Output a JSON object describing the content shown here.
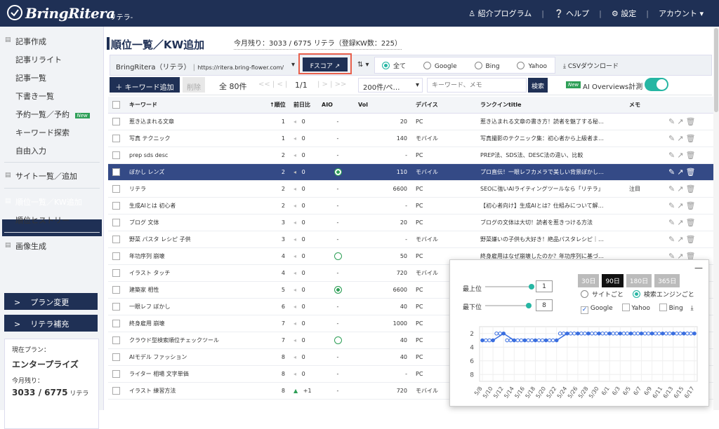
{
  "header": {
    "logo": "BringRitera",
    "logo_sub": "-リテラ-",
    "nav": [
      "紹介プログラム",
      "ヘルプ",
      "設定",
      "アカウント"
    ]
  },
  "sidebar": {
    "items": [
      "記事作成",
      "記事リライト",
      "記事一覧",
      "下書き一覧",
      "予約一覧／予約",
      "キーワード探索",
      "自由入力",
      "サイト一覧／追加",
      "順位一覧／KW追加",
      "順位ヒストリー",
      "画像生成"
    ],
    "new_badge": "New",
    "plan_change": "プラン変更",
    "ritera_refill": "リテラ補充",
    "plan_label": "現在プラン：",
    "plan_name": "エンタープライズ",
    "remaining_label": "今月残り：",
    "remaining_value": "3033 / 6775",
    "remaining_unit": "リテラ"
  },
  "main": {
    "title": "順位一覧／KW追加",
    "remain": "今月残り：3033 / 6775 リテラ（登録KW数：225）",
    "site_name": "BringRitera（リテラ）",
    "site_url": "https://ritera.bring-flower.com/",
    "fscore": "Fスコア",
    "filters": [
      "全て",
      "Google",
      "Bing",
      "Yahoo"
    ],
    "csv": "CSVダウンロード",
    "add_kw": "＋ キーワード追加",
    "delete": "削除",
    "total": "全 80件",
    "page": "1/1",
    "per_page": "200件/ペ…",
    "search_placeholder": "キーワード、メモ",
    "search_btn": "検索",
    "ai_badge": "New",
    "ai_label": "AI Overviews計測"
  },
  "table": {
    "headers": [
      "キーワード",
      "順位",
      "前日比",
      "AIO",
      "Vol",
      "デバイス",
      "ランクインtitle",
      "メモ"
    ],
    "rows": [
      [
        "惹き込まれる文章",
        "1",
        "0",
        "-",
        "20",
        "PC",
        "惹き込まれる文章の書き方！読者を魅了する秘…",
        ""
      ],
      [
        "写真 テクニック",
        "1",
        "0",
        "-",
        "140",
        "モバイル",
        "写真撮影のテクニック集：初心者から上級者ま…",
        ""
      ],
      [
        "prep sds desc",
        "2",
        "0",
        "-",
        "-",
        "PC",
        "PREP法、SDS法、DESC法の違い、比較",
        ""
      ],
      [
        "ぼかし レンズ",
        "2",
        "0",
        "g",
        "110",
        "モバイル",
        "プロ直伝！一眼レフカメラで美しい背景ぼかし…",
        ""
      ],
      [
        "リテラ",
        "2",
        "0",
        "-",
        "6600",
        "PC",
        "SEOに強いAIライティングツールなら「リテラ」",
        "注目"
      ],
      [
        "生成AIとは 初心者",
        "2",
        "0",
        "-",
        "-",
        "PC",
        "【初心者向け】生成AIとは？仕組みについて解…",
        ""
      ],
      [
        "ブログ 文体",
        "3",
        "0",
        "-",
        "20",
        "PC",
        "ブログの文体は大切！読者を惹きつける方法",
        ""
      ],
      [
        "野菜 パスタ レシピ 子供",
        "3",
        "0",
        "-",
        "-",
        "モバイル",
        "野菜嫌いの子供も大好き！絶品パスタレシピ｜…",
        ""
      ],
      [
        "年功序列 崩壊",
        "4",
        "0",
        "c",
        "50",
        "PC",
        "終身雇用はなぜ崩壊したのか？年功序列に基づ…",
        ""
      ],
      [
        "イラスト タッチ",
        "4",
        "0",
        "-",
        "720",
        "モバイル",
        "",
        ""
      ],
      [
        "建築家 相性",
        "5",
        "0",
        "g",
        "6600",
        "PC",
        "",
        ""
      ],
      [
        "一眼レフ ぼかし",
        "6",
        "0",
        "-",
        "40",
        "PC",
        "",
        ""
      ],
      [
        "終身雇用 崩壊",
        "7",
        "0",
        "-",
        "1000",
        "PC",
        "",
        ""
      ],
      [
        "クラウド型検索順位チェックツール",
        "7",
        "0",
        "c",
        "40",
        "PC",
        "",
        ""
      ],
      [
        "AIモデル ファッション",
        "8",
        "0",
        "-",
        "40",
        "PC",
        "",
        ""
      ],
      [
        "ライター 相場 文字単価",
        "8",
        "0",
        "-",
        "-",
        "PC",
        "",
        ""
      ],
      [
        "イラスト 練習方法",
        "8",
        "+1",
        "-",
        "720",
        "モバイル",
        "",
        ""
      ]
    ]
  },
  "popup": {
    "ranges": [
      "30日",
      "90日",
      "180日",
      "365日"
    ],
    "top_label": "最上位",
    "top_value": "1",
    "bottom_label": "最下位",
    "bottom_value": "8",
    "mode": [
      "サイトごと",
      "検索エンジンごと"
    ],
    "engines": [
      "Google",
      "Yahoo",
      "Bing"
    ],
    "chart_data": {
      "type": "line",
      "x": [
        "5/8",
        "5/10",
        "5/12",
        "5/14",
        "5/16",
        "5/18",
        "5/20",
        "5/22",
        "5/24",
        "5/26",
        "5/28",
        "5/30",
        "6/1",
        "6/3",
        "6/5",
        "6/7",
        "6/9",
        "6/11",
        "6/13",
        "6/15",
        "6/17"
      ],
      "y_ticks": [
        2,
        4,
        6,
        8
      ],
      "ylim": [
        1,
        9
      ],
      "series": [
        {
          "values": [
            3,
            3,
            2,
            3,
            3,
            3,
            3,
            3,
            2,
            2,
            2,
            2,
            2,
            2,
            2,
            2,
            2,
            2,
            2,
            2,
            2
          ]
        }
      ]
    }
  }
}
